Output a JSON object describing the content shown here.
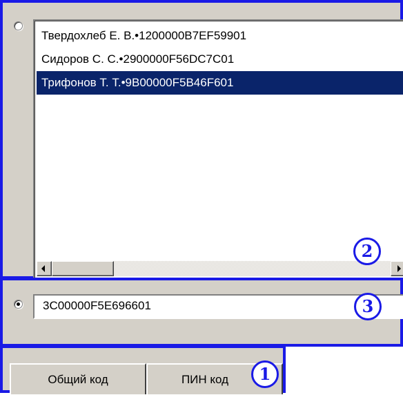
{
  "certificate_list": {
    "items": [
      {
        "label": "Твердохлеб Е. В.•1200000B7EF59901",
        "selected": false
      },
      {
        "label": "Сидоров С. С.•2900000F56DC7C01",
        "selected": false
      },
      {
        "label": "Трифонов Т. Т.•9B00000F5B46F601",
        "selected": true
      }
    ],
    "radio_selected": false
  },
  "code_entry": {
    "value": "3C00000F5E696601",
    "radio_selected": true
  },
  "tabs": {
    "common_label": "Общий код",
    "pin_label": "ПИН код"
  },
  "markers": {
    "m1": "1",
    "m2": "2",
    "m3": "3"
  },
  "colors": {
    "annotation_blue": "#1a1ae6",
    "selection_bg": "#0a246a",
    "panel_bg": "#d4d0c8"
  },
  "icons": {
    "scroll_left": "left-arrow-icon",
    "scroll_right": "right-arrow-icon"
  }
}
